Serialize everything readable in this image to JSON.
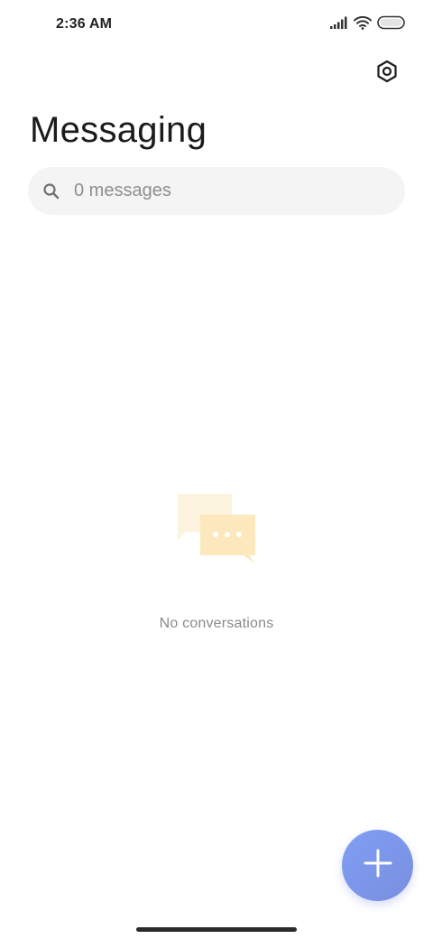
{
  "status_bar": {
    "time": "2:36 AM",
    "icons": [
      "signal-icon",
      "wifi-icon",
      "battery-icon"
    ]
  },
  "header": {
    "title": "Messaging",
    "settings_icon": "settings-hexagon-icon"
  },
  "search": {
    "text": "0 messages",
    "icon": "search-icon"
  },
  "empty_state": {
    "illustration": "chat-bubbles-icon",
    "message": "No conversations"
  },
  "fab": {
    "icon": "plus-icon"
  },
  "colors": {
    "accent": "#7f9ef3",
    "bubble_light": "#fdf3dd",
    "bubble_dark": "#fce6b5"
  }
}
